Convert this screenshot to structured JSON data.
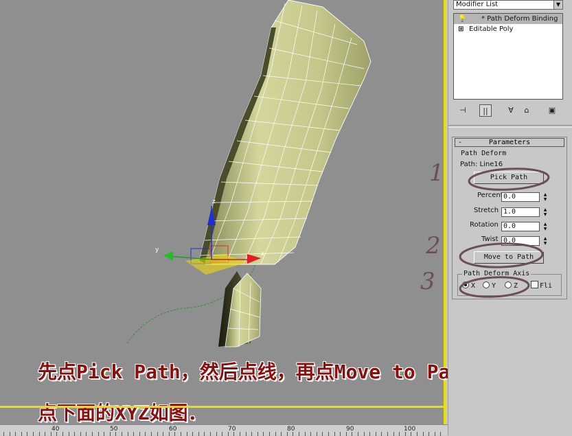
{
  "modifier_list": {
    "label": "Modifier List"
  },
  "stack": {
    "items": [
      {
        "label": "* Path Deform Binding",
        "icon": "lightbulb-icon",
        "selected": true
      },
      {
        "label": "Editable Poly",
        "icon": "expand-plus-icon",
        "selected": false
      }
    ]
  },
  "stack_toolbar": {
    "icons": [
      "pin-stack-icon",
      "show-end-result-icon",
      "make-unique-icon",
      "remove-modifier-icon",
      "configure-sets-icon"
    ]
  },
  "parameters": {
    "title": "Parameters",
    "path_deform_group": "Path Deform",
    "path_label": "Path: Line16",
    "pick_path_button": "Pick Path",
    "fields": [
      {
        "label": "Percent",
        "value": "0.0"
      },
      {
        "label": "Stretch",
        "value": "1.0"
      },
      {
        "label": "Rotation",
        "value": "0.0"
      },
      {
        "label": "Twist",
        "value": "0.0"
      }
    ],
    "move_to_path_button": "Move to Path",
    "axis_group": "Path Deform Axis",
    "axis_options": [
      {
        "label": "X",
        "selected": true
      },
      {
        "label": "Y",
        "selected": false
      },
      {
        "label": "Z",
        "selected": false
      }
    ],
    "flip_label": "Fli"
  },
  "annotations": {
    "step_numbers": [
      "1",
      "2",
      "3"
    ]
  },
  "captions": {
    "line1": "先点Pick Path，然后点线，再点Move to Path，",
    "line2": "点下面的XYZ如图．"
  },
  "gizmo_labels": {
    "x": "x",
    "y": "y",
    "z": "z"
  },
  "time_ruler": {
    "labels": [
      "40",
      "50",
      "60",
      "70",
      "80",
      "90",
      "100"
    ]
  },
  "colors": {
    "viewport_active_border": "#e6e100",
    "mesh": "#c7c98f",
    "caption": "#8a1010"
  }
}
